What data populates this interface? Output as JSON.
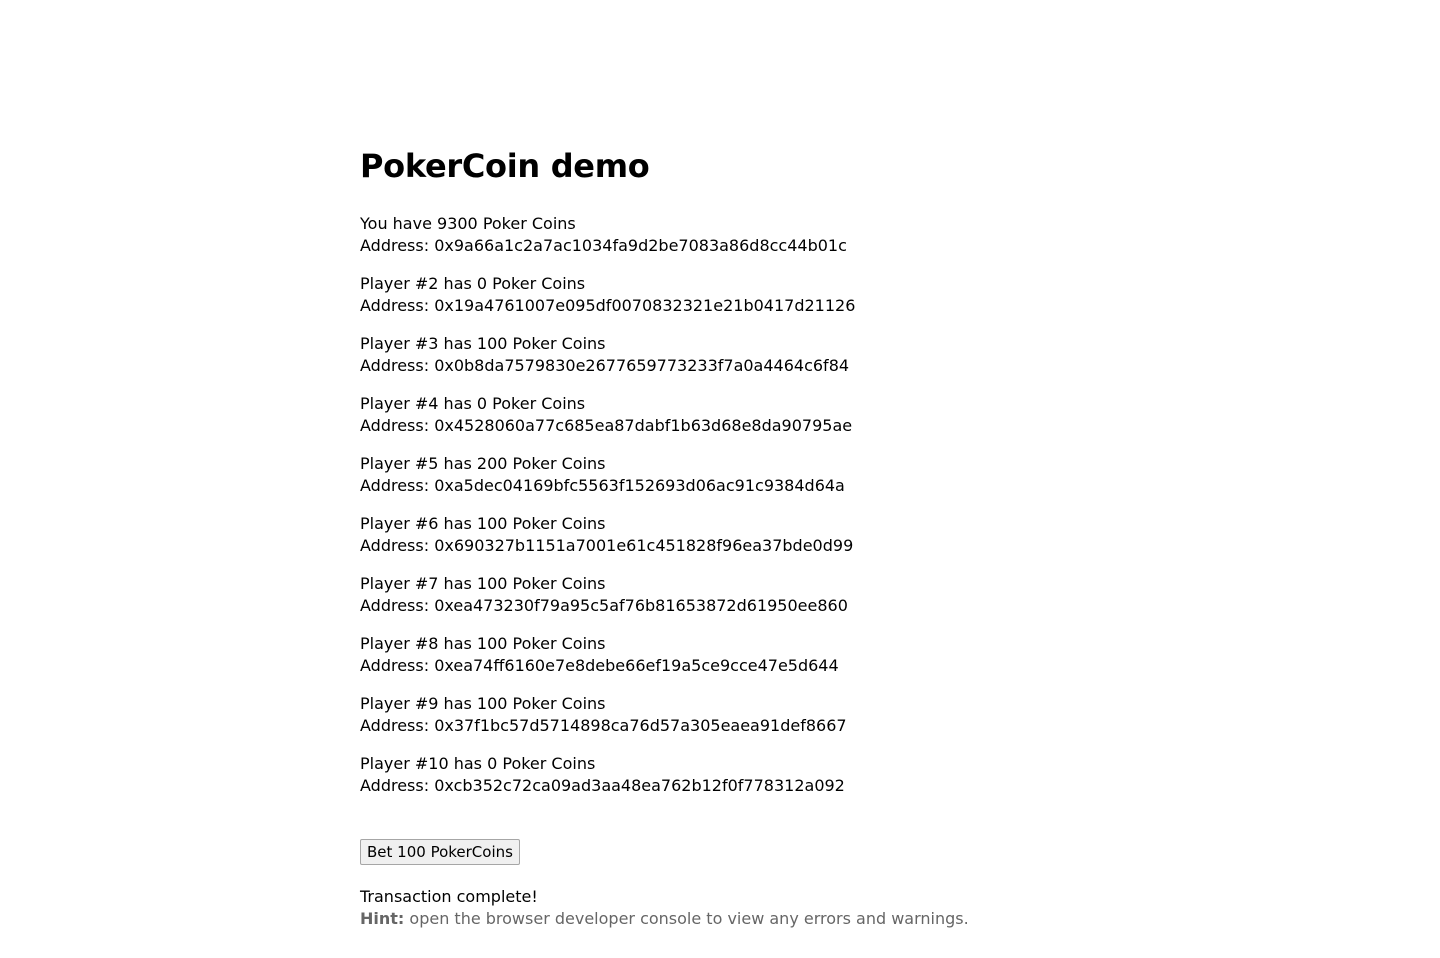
{
  "header": {
    "title": "PokerCoin demo"
  },
  "players": [
    {
      "status": "You have 9300 Poker Coins",
      "address": "Address: 0x9a66a1c2a7ac1034fa9d2be7083a86d8cc44b01c"
    },
    {
      "status": "Player #2 has 0 Poker Coins",
      "address": "Address: 0x19a4761007e095df0070832321e21b0417d21126"
    },
    {
      "status": "Player #3 has 100 Poker Coins",
      "address": "Address: 0x0b8da7579830e2677659773233f7a0a4464c6f84"
    },
    {
      "status": "Player #4 has 0 Poker Coins",
      "address": "Address: 0x4528060a77c685ea87dabf1b63d68e8da90795ae"
    },
    {
      "status": "Player #5 has 200 Poker Coins",
      "address": "Address: 0xa5dec04169bfc5563f152693d06ac91c9384d64a"
    },
    {
      "status": "Player #6 has 100 Poker Coins",
      "address": "Address: 0x690327b1151a7001e61c451828f96ea37bde0d99"
    },
    {
      "status": "Player #7 has 100 Poker Coins",
      "address": "Address: 0xea473230f79a95c5af76b81653872d61950ee860"
    },
    {
      "status": "Player #8 has 100 Poker Coins",
      "address": "Address: 0xea74ff6160e7e8debe66ef19a5ce9cce47e5d644"
    },
    {
      "status": "Player #9 has 100 Poker Coins",
      "address": "Address: 0x37f1bc57d5714898ca76d57a305eaea91def8667"
    },
    {
      "status": "Player #10 has 0 Poker Coins",
      "address": "Address: 0xcb352c72ca09ad3aa48ea762b12f0f778312a092"
    }
  ],
  "actions": {
    "bet_label": "Bet 100 PokerCoins"
  },
  "status": {
    "message": "Transaction complete!",
    "hint_label": "Hint:",
    "hint_text": " open the browser developer console to view any errors and warnings."
  }
}
